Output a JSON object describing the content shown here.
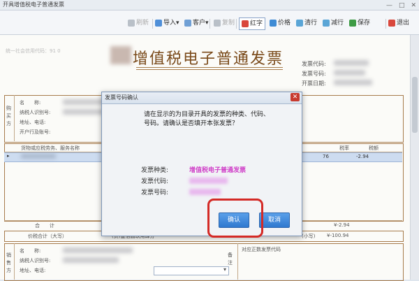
{
  "window": {
    "title": "开具增值税电子普通发票"
  },
  "toolbar": {
    "items": [
      {
        "label": "刷新",
        "dim": true,
        "color": "#b9c0c8"
      },
      {
        "label": "导入",
        "arrow": "▾",
        "dim": false,
        "color": "#4f8fd8"
      },
      {
        "label": "客户",
        "arrow": "▾",
        "dim": false,
        "color": "#6f9fd5"
      },
      {
        "label": "复制",
        "dim": true,
        "color": "#b9c0c8"
      },
      {
        "label": "红字",
        "dim": false,
        "color": "#d9473c",
        "highlight": true
      },
      {
        "label": "价格",
        "dim": false,
        "color": "#3e8bd5"
      },
      {
        "label": "清行",
        "dim": false,
        "color": "#5aa5d6"
      },
      {
        "label": "减行",
        "dim": false,
        "color": "#5aa5d6"
      },
      {
        "label": "保存",
        "dim": false,
        "color": "#3d9b45"
      },
      {
        "label": "退出",
        "dim": false,
        "color": "#d9473c"
      }
    ]
  },
  "invoice": {
    "banner": "统一社会信用代码：91 0",
    "title": "增值税电子普通发票",
    "meta": {
      "code": "发票代码:",
      "number": "发票号码:",
      "date": "开票日期:"
    },
    "buyer_side": "购买方",
    "buyer_fields": [
      "名　　称:",
      "纳税人识别号:",
      "地址、电话:",
      "开户行及账号:"
    ],
    "col_item": "货物或应税劳务、服务名称",
    "col_rate": "税率",
    "col_tax": "税额",
    "row_rate": "76",
    "row_tax": "-2.94",
    "row_marker": "▸",
    "total_label": "合　　计",
    "total_tax": "¥-2.94",
    "grand_label": "价税合计（大写）",
    "grand_text": "(负)壹佰圆玖角肆分",
    "grand_small": "(小写)",
    "grand_value": "¥-100.94",
    "seller_side": "销售方",
    "seller_fields": [
      "名　　称:",
      "纳税人识别号:",
      "地址、电话:"
    ],
    "remark_label": "备注",
    "remark_text": "对应正数发票代码"
  },
  "dialog": {
    "caption": "发票号码确认",
    "close": "✕",
    "message": "请在显示的为目录开具的发票的种类、代码、号码。请确认是否填开本张发票？",
    "kind_label": "发票种类:",
    "kind_value": "增值税电子普通发票",
    "code_label": "发票代码:",
    "number_label": "发票号码:",
    "ok": "确认",
    "cancel": "取消"
  }
}
